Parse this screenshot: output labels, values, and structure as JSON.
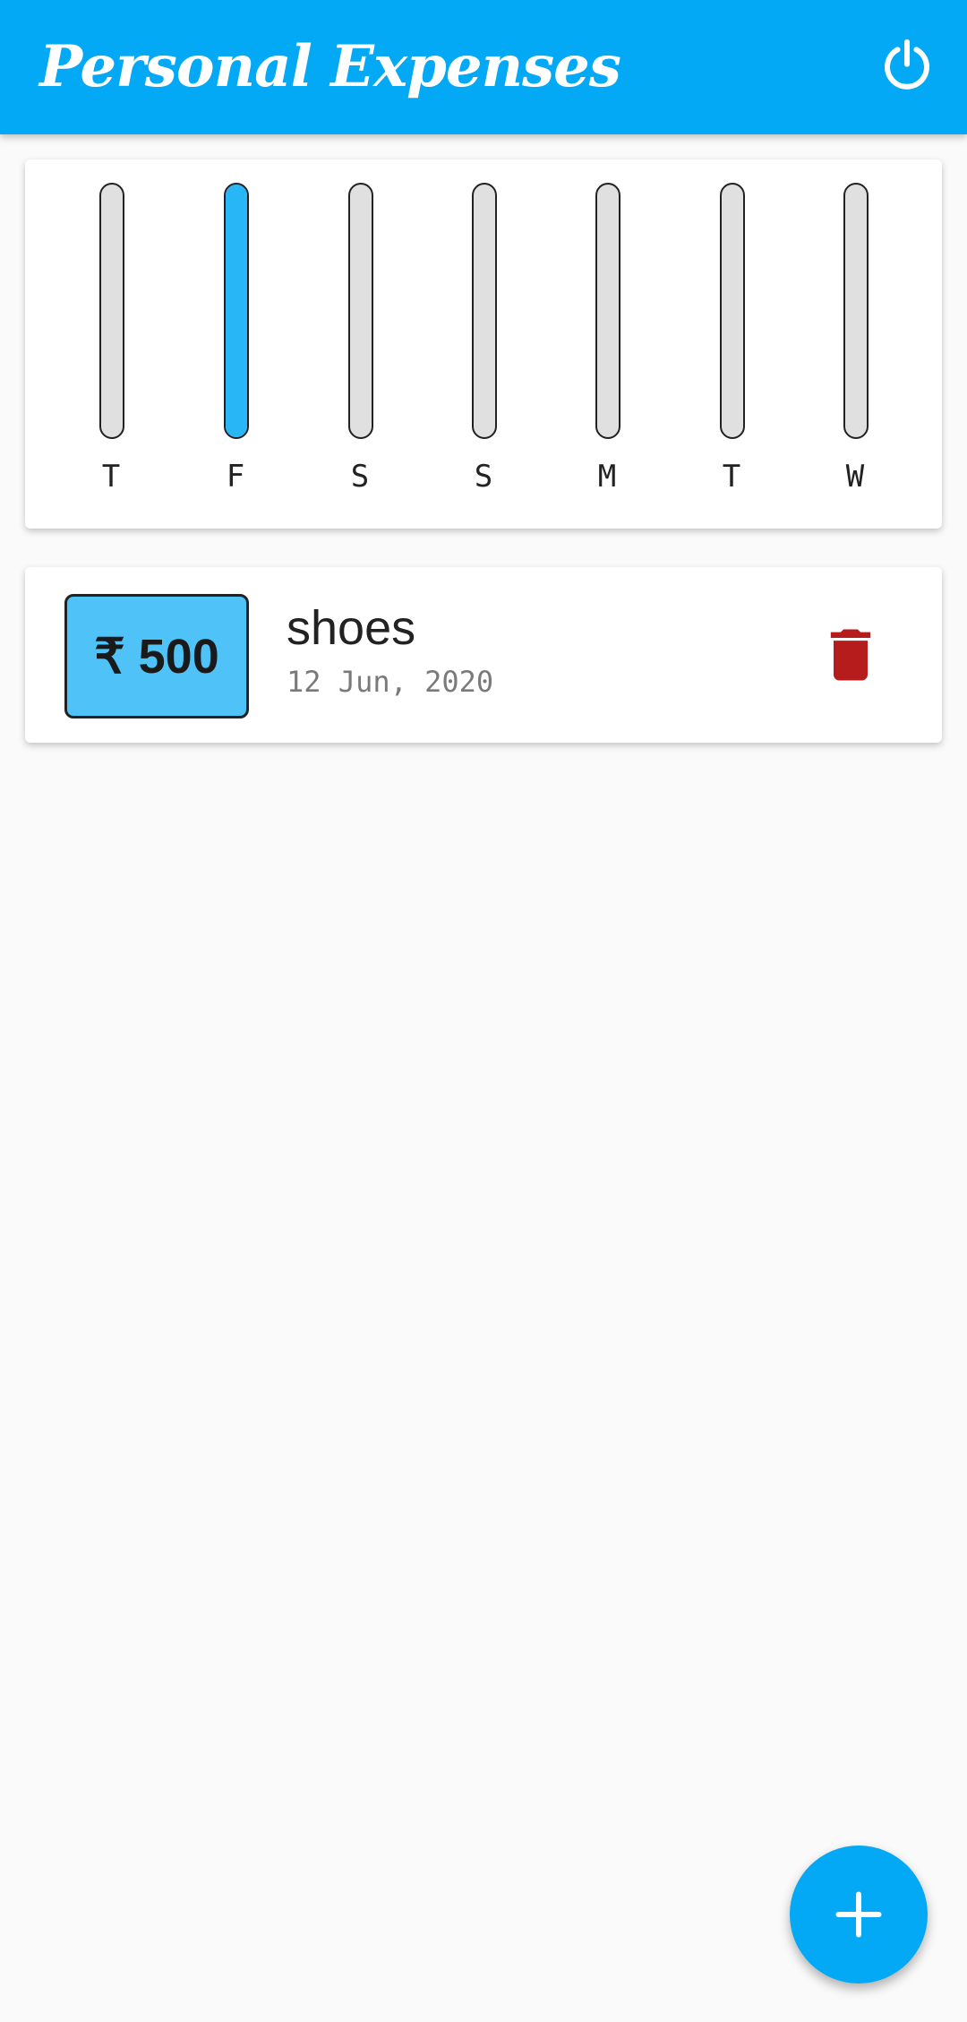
{
  "app_bar": {
    "title": "Personal Expenses",
    "background_color": "#03a9f4",
    "action_icon": "power-icon"
  },
  "chart_data": {
    "type": "bar",
    "categories": [
      "T",
      "F",
      "S",
      "S",
      "M",
      "T",
      "W"
    ],
    "values": [
      0,
      1,
      0,
      0,
      0,
      0,
      0
    ],
    "fill_color": "#29b6f6",
    "track_color": "#e0e0e0",
    "ylim": [
      0,
      1
    ]
  },
  "transactions": [
    {
      "amount": "₹ 500",
      "title": "shoes",
      "date": "12 Jun, 2020",
      "amount_bg_color": "#4fc3f7",
      "delete_icon": "trash-icon",
      "delete_color": "#b71c1c"
    }
  ],
  "fab": {
    "icon": "plus-icon",
    "color": "#03a9f4"
  }
}
